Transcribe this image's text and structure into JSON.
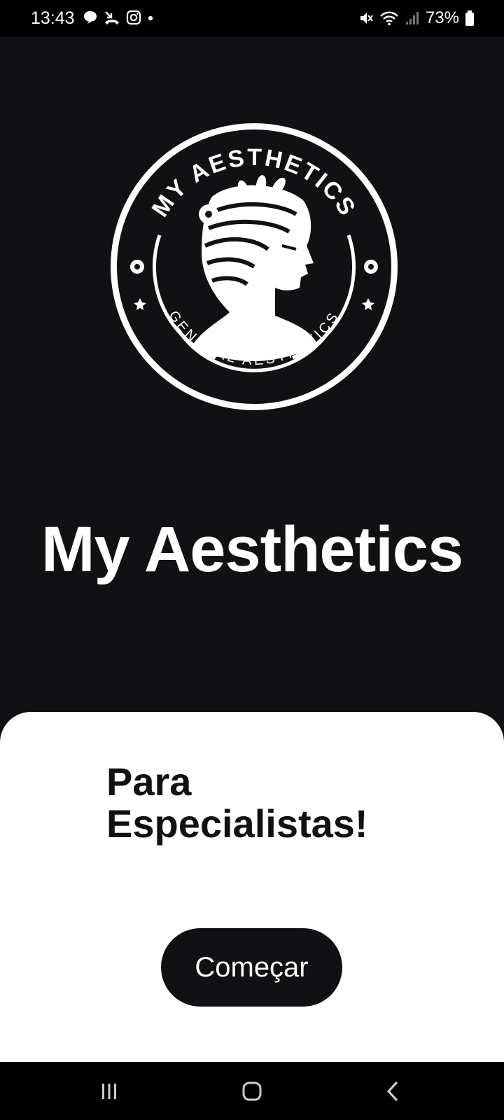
{
  "status_bar": {
    "time": "13:43",
    "battery": "73%",
    "notification_icons": [
      "chat-bubble-icon",
      "missed-call-icon",
      "instagram-icon",
      "dot-icon"
    ],
    "system_icons": [
      "mute-icon",
      "wifi-icon",
      "signal-icon",
      "battery-icon"
    ]
  },
  "logo": {
    "arc_top_text": "MY AESTHETICS",
    "arc_bottom_text": "GENERAL AESTHETICS"
  },
  "app": {
    "title": "My Aesthetics"
  },
  "sheet": {
    "heading_line1": "Para",
    "heading_line2": "Especialistas!",
    "start_button": "Começar"
  },
  "nav_bar": {
    "icons": [
      "recent-apps-icon",
      "home-icon",
      "back-icon"
    ]
  },
  "colors": {
    "background": "#111114",
    "sheet": "#ffffff",
    "button": "#111114"
  }
}
